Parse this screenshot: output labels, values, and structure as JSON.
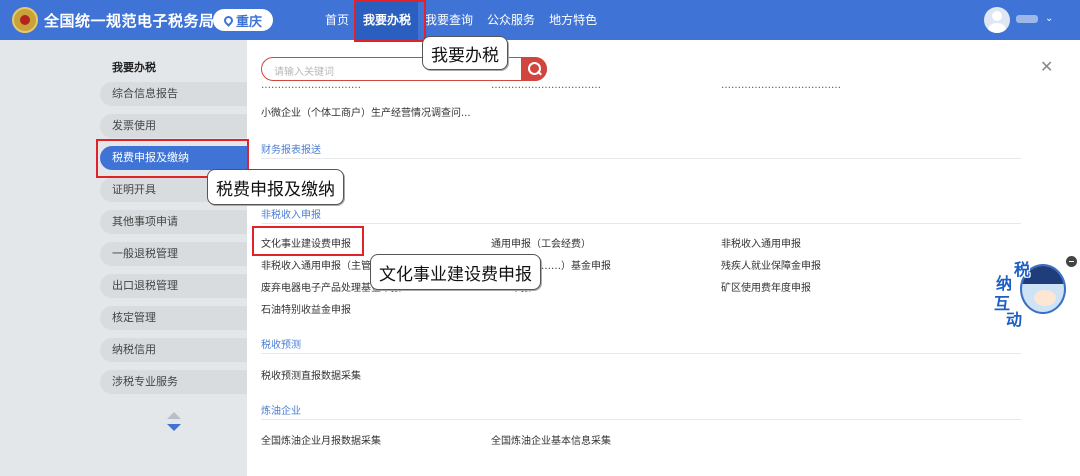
{
  "header": {
    "site_title": "全国统一规范电子税务局",
    "region": "重庆",
    "nav": [
      "首页",
      "我要办税",
      "我要查询",
      "公众服务",
      "地方特色"
    ]
  },
  "sidebar": {
    "title": "我要办税",
    "items": [
      "综合信息报告",
      "发票使用",
      "税费申报及缴纳",
      "证明开具",
      "其他事项申请",
      "一般退税管理",
      "出口退税管理",
      "核定管理",
      "纳税信用",
      "涉税专业服务"
    ]
  },
  "search": {
    "placeholder": "请输入关键词"
  },
  "content": {
    "partial_row": [
      "…………………………",
      "……………………………",
      "………………………………"
    ],
    "small_business_survey": "小微企业（个体工商户）生产经营情况调查问...",
    "sections": {
      "financial": {
        "title": "财务报表报送"
      },
      "nontax": {
        "title": "非税收入申报",
        "links": [
          [
            "文化事业建设费申报",
            "通用申报（工会经费）",
            "非税收入通用申报"
          ],
          [
            "非税收入通用申报（主管",
            "……申报（……）基金申报",
            "残疾人就业保障金申报"
          ],
          [
            "废弃电器电子产品处理基金申报",
            "……申报",
            "矿区使用费年度申报"
          ],
          [
            "石油特别收益金申报"
          ]
        ]
      },
      "forecast": {
        "title": "税收预测",
        "links": [
          "税收预测直报数据采集"
        ]
      },
      "refinery": {
        "title": "炼油企业",
        "links": [
          "全国炼油企业月报数据采集",
          "全国炼油企业基本信息采集"
        ]
      }
    }
  },
  "annotations": {
    "callout_nav": "我要办税",
    "callout_sidebar": "税费申报及缴纳",
    "callout_link": "文化事业建设费申报"
  },
  "mascot": {
    "chars": [
      "纳",
      "税",
      "互",
      "动"
    ]
  },
  "colors": {
    "primary": "#3f74d6",
    "highlight": "#e0222a",
    "section": "#4a7fd4"
  }
}
